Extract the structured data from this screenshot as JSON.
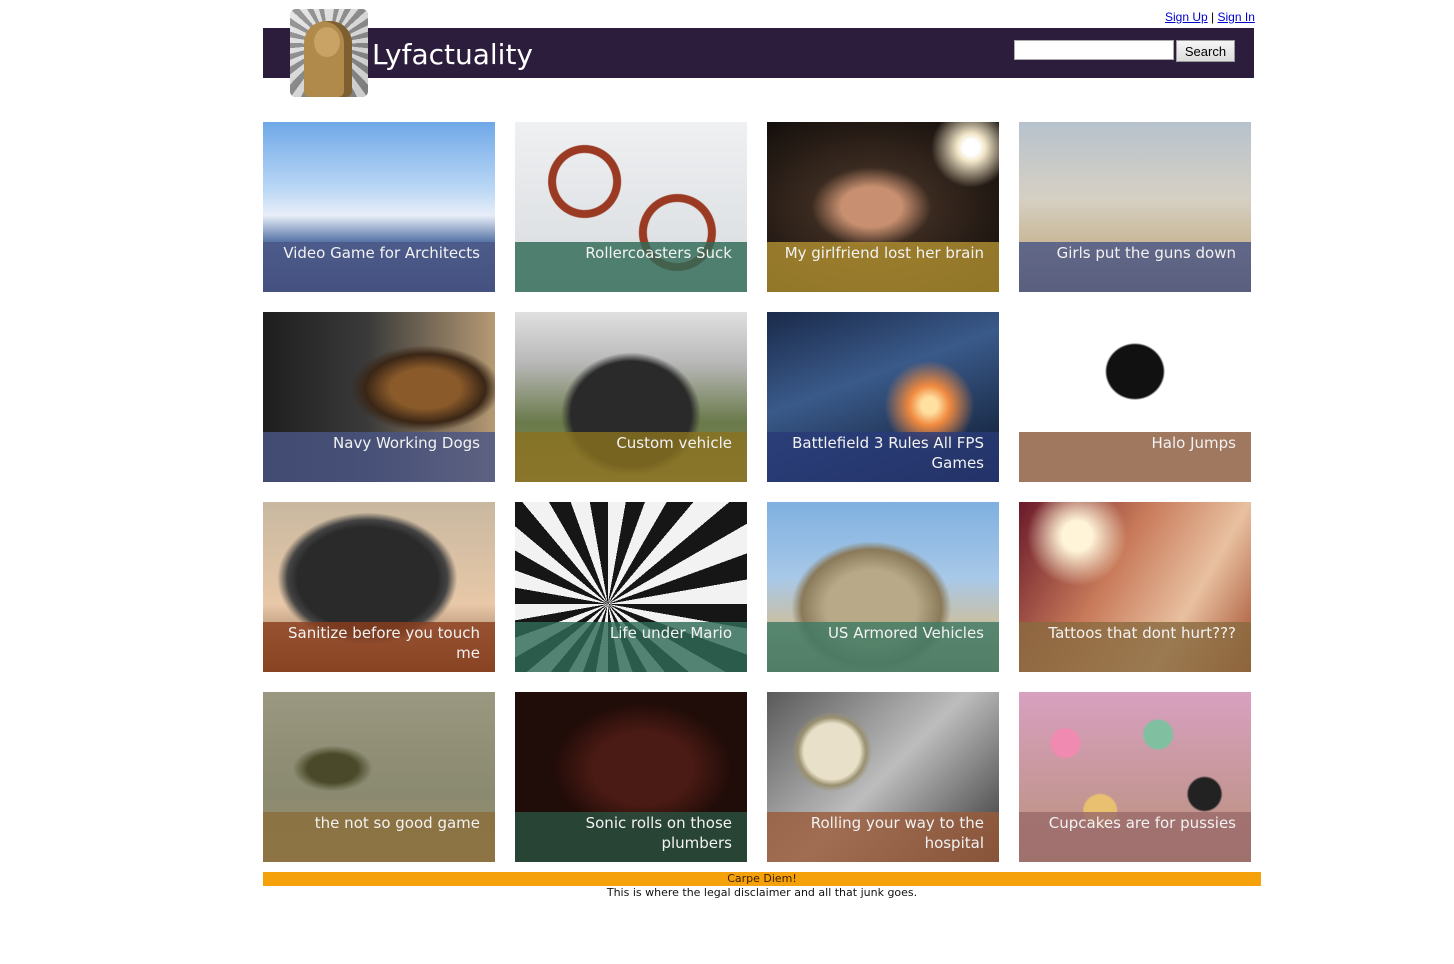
{
  "header": {
    "sign_up": "Sign Up",
    "separator": "|",
    "sign_in": "Sign In",
    "site_title": "Lyfactuality",
    "search_value": "",
    "search_button": "Search"
  },
  "tiles": [
    {
      "label": "Video Game for Architects",
      "caption_color": "#4a5585",
      "image": "city-skyline"
    },
    {
      "label": "Rollercoasters Suck",
      "caption_color": "#2f6a55",
      "image": "rollercoaster-loops"
    },
    {
      "label": "My girlfriend lost her brain",
      "caption_color": "#b08f2f",
      "image": "woman-portrait"
    },
    {
      "label": "Girls put the guns down",
      "caption_color": "#4a5585",
      "image": "desert-woman-gun"
    },
    {
      "label": "Navy Working Dogs",
      "caption_color": "#4a5585",
      "image": "dog-and-rifle"
    },
    {
      "label": "Custom vehicle",
      "caption_color": "#8a7220",
      "image": "vintage-car"
    },
    {
      "label": "Battlefield 3 Rules All FPS Games",
      "caption_color": "#2a3a78",
      "image": "soldier-explosion"
    },
    {
      "label": "Halo Jumps",
      "caption_color": "#8b5a3c",
      "image": "halo-insignia"
    },
    {
      "label": "Sanitize before you touch me",
      "caption_color": "#8b3e1e",
      "image": "tablet-hands"
    },
    {
      "label": "Life under Mario",
      "caption_color": "#2f6a55",
      "image": "nes-controller-rays"
    },
    {
      "label": "US Armored Vehicles",
      "caption_color": "#3f7a64",
      "image": "tank"
    },
    {
      "label": "Tattoos that dont hurt???",
      "caption_color": "#8a6a40",
      "image": "tattoo-back"
    },
    {
      "label": "the not so good game",
      "caption_color": "#8a6e3a",
      "image": "graffiti-wall"
    },
    {
      "label": "Sonic rolls on those plumbers",
      "caption_color": "#2a5040",
      "image": "genesis-console"
    },
    {
      "label": "Rolling your way to the hospital",
      "caption_color": "#9a5a3a",
      "image": "skateboard-wheel"
    },
    {
      "label": "Cupcakes are for pussies",
      "caption_color": "#9a6a6a",
      "image": "cupcakes"
    }
  ],
  "footer": {
    "motto": "Carpe Diem!",
    "disclaimer": "This is where the legal disclaimer and all that junk goes."
  }
}
